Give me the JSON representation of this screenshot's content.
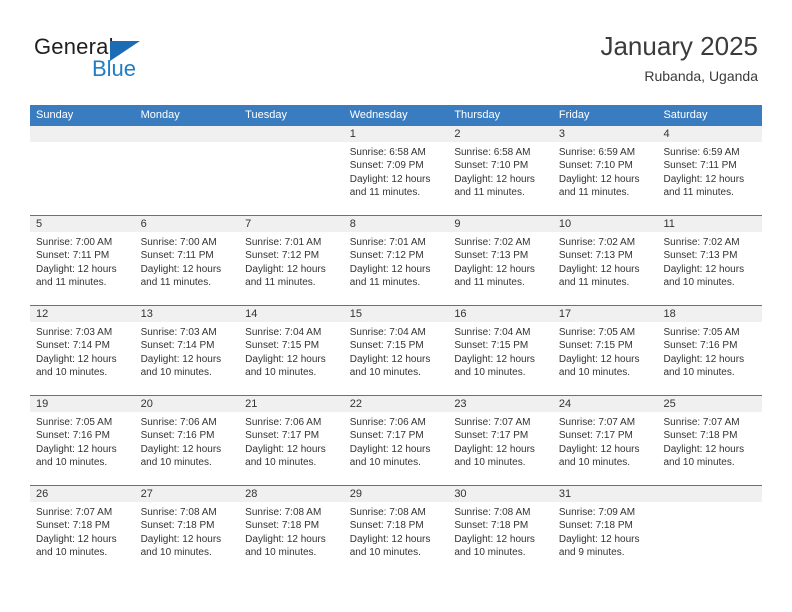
{
  "brand": {
    "name_part1": "General",
    "name_part2": "Blue",
    "triangle_color": "#1b6cb5",
    "blue_color": "#1f7ec4"
  },
  "header": {
    "title": "January 2025",
    "subtitle": "Rubanda, Uganda"
  },
  "theme": {
    "header_blue": "#3a7cc0",
    "day_band_gray": "#f0f0f0",
    "text_color": "#333333"
  },
  "weekdays": [
    "Sunday",
    "Monday",
    "Tuesday",
    "Wednesday",
    "Thursday",
    "Friday",
    "Saturday"
  ],
  "weeks": [
    [
      {
        "day": "",
        "sunrise": "",
        "sunset": "",
        "daylight1": "",
        "daylight2": ""
      },
      {
        "day": "",
        "sunrise": "",
        "sunset": "",
        "daylight1": "",
        "daylight2": ""
      },
      {
        "day": "",
        "sunrise": "",
        "sunset": "",
        "daylight1": "",
        "daylight2": ""
      },
      {
        "day": "1",
        "sunrise": "Sunrise: 6:58 AM",
        "sunset": "Sunset: 7:09 PM",
        "daylight1": "Daylight: 12 hours",
        "daylight2": "and 11 minutes."
      },
      {
        "day": "2",
        "sunrise": "Sunrise: 6:58 AM",
        "sunset": "Sunset: 7:10 PM",
        "daylight1": "Daylight: 12 hours",
        "daylight2": "and 11 minutes."
      },
      {
        "day": "3",
        "sunrise": "Sunrise: 6:59 AM",
        "sunset": "Sunset: 7:10 PM",
        "daylight1": "Daylight: 12 hours",
        "daylight2": "and 11 minutes."
      },
      {
        "day": "4",
        "sunrise": "Sunrise: 6:59 AM",
        "sunset": "Sunset: 7:11 PM",
        "daylight1": "Daylight: 12 hours",
        "daylight2": "and 11 minutes."
      }
    ],
    [
      {
        "day": "5",
        "sunrise": "Sunrise: 7:00 AM",
        "sunset": "Sunset: 7:11 PM",
        "daylight1": "Daylight: 12 hours",
        "daylight2": "and 11 minutes."
      },
      {
        "day": "6",
        "sunrise": "Sunrise: 7:00 AM",
        "sunset": "Sunset: 7:11 PM",
        "daylight1": "Daylight: 12 hours",
        "daylight2": "and 11 minutes."
      },
      {
        "day": "7",
        "sunrise": "Sunrise: 7:01 AM",
        "sunset": "Sunset: 7:12 PM",
        "daylight1": "Daylight: 12 hours",
        "daylight2": "and 11 minutes."
      },
      {
        "day": "8",
        "sunrise": "Sunrise: 7:01 AM",
        "sunset": "Sunset: 7:12 PM",
        "daylight1": "Daylight: 12 hours",
        "daylight2": "and 11 minutes."
      },
      {
        "day": "9",
        "sunrise": "Sunrise: 7:02 AM",
        "sunset": "Sunset: 7:13 PM",
        "daylight1": "Daylight: 12 hours",
        "daylight2": "and 11 minutes."
      },
      {
        "day": "10",
        "sunrise": "Sunrise: 7:02 AM",
        "sunset": "Sunset: 7:13 PM",
        "daylight1": "Daylight: 12 hours",
        "daylight2": "and 11 minutes."
      },
      {
        "day": "11",
        "sunrise": "Sunrise: 7:02 AM",
        "sunset": "Sunset: 7:13 PM",
        "daylight1": "Daylight: 12 hours",
        "daylight2": "and 10 minutes."
      }
    ],
    [
      {
        "day": "12",
        "sunrise": "Sunrise: 7:03 AM",
        "sunset": "Sunset: 7:14 PM",
        "daylight1": "Daylight: 12 hours",
        "daylight2": "and 10 minutes."
      },
      {
        "day": "13",
        "sunrise": "Sunrise: 7:03 AM",
        "sunset": "Sunset: 7:14 PM",
        "daylight1": "Daylight: 12 hours",
        "daylight2": "and 10 minutes."
      },
      {
        "day": "14",
        "sunrise": "Sunrise: 7:04 AM",
        "sunset": "Sunset: 7:15 PM",
        "daylight1": "Daylight: 12 hours",
        "daylight2": "and 10 minutes."
      },
      {
        "day": "15",
        "sunrise": "Sunrise: 7:04 AM",
        "sunset": "Sunset: 7:15 PM",
        "daylight1": "Daylight: 12 hours",
        "daylight2": "and 10 minutes."
      },
      {
        "day": "16",
        "sunrise": "Sunrise: 7:04 AM",
        "sunset": "Sunset: 7:15 PM",
        "daylight1": "Daylight: 12 hours",
        "daylight2": "and 10 minutes."
      },
      {
        "day": "17",
        "sunrise": "Sunrise: 7:05 AM",
        "sunset": "Sunset: 7:15 PM",
        "daylight1": "Daylight: 12 hours",
        "daylight2": "and 10 minutes."
      },
      {
        "day": "18",
        "sunrise": "Sunrise: 7:05 AM",
        "sunset": "Sunset: 7:16 PM",
        "daylight1": "Daylight: 12 hours",
        "daylight2": "and 10 minutes."
      }
    ],
    [
      {
        "day": "19",
        "sunrise": "Sunrise: 7:05 AM",
        "sunset": "Sunset: 7:16 PM",
        "daylight1": "Daylight: 12 hours",
        "daylight2": "and 10 minutes."
      },
      {
        "day": "20",
        "sunrise": "Sunrise: 7:06 AM",
        "sunset": "Sunset: 7:16 PM",
        "daylight1": "Daylight: 12 hours",
        "daylight2": "and 10 minutes."
      },
      {
        "day": "21",
        "sunrise": "Sunrise: 7:06 AM",
        "sunset": "Sunset: 7:17 PM",
        "daylight1": "Daylight: 12 hours",
        "daylight2": "and 10 minutes."
      },
      {
        "day": "22",
        "sunrise": "Sunrise: 7:06 AM",
        "sunset": "Sunset: 7:17 PM",
        "daylight1": "Daylight: 12 hours",
        "daylight2": "and 10 minutes."
      },
      {
        "day": "23",
        "sunrise": "Sunrise: 7:07 AM",
        "sunset": "Sunset: 7:17 PM",
        "daylight1": "Daylight: 12 hours",
        "daylight2": "and 10 minutes."
      },
      {
        "day": "24",
        "sunrise": "Sunrise: 7:07 AM",
        "sunset": "Sunset: 7:17 PM",
        "daylight1": "Daylight: 12 hours",
        "daylight2": "and 10 minutes."
      },
      {
        "day": "25",
        "sunrise": "Sunrise: 7:07 AM",
        "sunset": "Sunset: 7:18 PM",
        "daylight1": "Daylight: 12 hours",
        "daylight2": "and 10 minutes."
      }
    ],
    [
      {
        "day": "26",
        "sunrise": "Sunrise: 7:07 AM",
        "sunset": "Sunset: 7:18 PM",
        "daylight1": "Daylight: 12 hours",
        "daylight2": "and 10 minutes."
      },
      {
        "day": "27",
        "sunrise": "Sunrise: 7:08 AM",
        "sunset": "Sunset: 7:18 PM",
        "daylight1": "Daylight: 12 hours",
        "daylight2": "and 10 minutes."
      },
      {
        "day": "28",
        "sunrise": "Sunrise: 7:08 AM",
        "sunset": "Sunset: 7:18 PM",
        "daylight1": "Daylight: 12 hours",
        "daylight2": "and 10 minutes."
      },
      {
        "day": "29",
        "sunrise": "Sunrise: 7:08 AM",
        "sunset": "Sunset: 7:18 PM",
        "daylight1": "Daylight: 12 hours",
        "daylight2": "and 10 minutes."
      },
      {
        "day": "30",
        "sunrise": "Sunrise: 7:08 AM",
        "sunset": "Sunset: 7:18 PM",
        "daylight1": "Daylight: 12 hours",
        "daylight2": "and 10 minutes."
      },
      {
        "day": "31",
        "sunrise": "Sunrise: 7:09 AM",
        "sunset": "Sunset: 7:18 PM",
        "daylight1": "Daylight: 12 hours",
        "daylight2": "and 9 minutes."
      },
      {
        "day": "",
        "sunrise": "",
        "sunset": "",
        "daylight1": "",
        "daylight2": ""
      }
    ]
  ]
}
